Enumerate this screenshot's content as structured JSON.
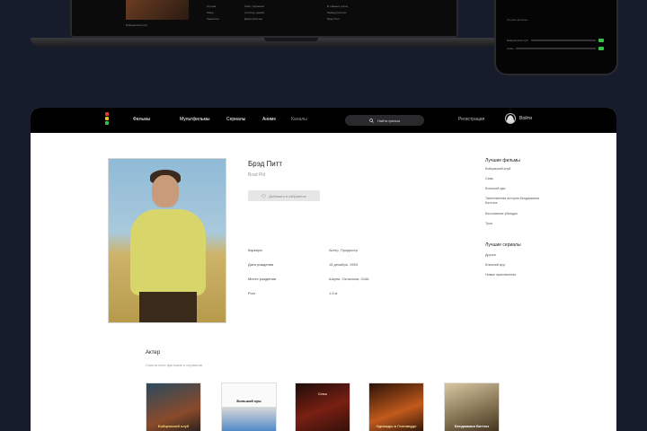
{
  "laptop_preview": {
    "caption": "Бойцовский клуб",
    "col1": [
      "Страна",
      "Жанр",
      "Режиссёр"
    ],
    "col2": [
      "США, Германия",
      "триллер, драма",
      "Дэвид Финчер"
    ],
    "col3": [
      "В главных ролях",
      "Эдвард Нортон",
      "Брэд Питт"
    ]
  },
  "phone_preview": {
    "title": "Лучшие фильмы",
    "rows": [
      "Бойцовский клуб",
      "Семь"
    ]
  },
  "nav": {
    "items": [
      "Фильмы",
      "Мультфильмы",
      "Сериалы",
      "Аниме",
      "Каналы"
    ],
    "search_label": "Найти фильм",
    "signup": "Регистрация",
    "login": "Войти"
  },
  "actor": {
    "name": "Брэд Питт",
    "name_en": "Brad Pitt",
    "favorite_label": "Добавить в избранное",
    "details": [
      {
        "label": "Карьера",
        "value": "Актер, Продюсер"
      },
      {
        "label": "Дата рождения",
        "value": "18 декабря, 1963"
      },
      {
        "label": "Место рождения",
        "value": "Шауни, Оклахома, США"
      },
      {
        "label": "Рост",
        "value": "1.8 м"
      }
    ]
  },
  "sidebar": {
    "best_films_title": "Лучшие фильмы",
    "best_films": [
      "Бойцовский клуб",
      "Семь",
      "Большой куш",
      "Таинственная история Бенджамина Баттона",
      "Бесславные ублюдки",
      "Троя"
    ],
    "best_series_title": "Лучшие сериалы",
    "best_series": [
      "Друзья",
      "Ближний круг",
      "Новые приключения"
    ]
  },
  "filmography": {
    "title": "Актер",
    "subtitle": "Список всех фильмов и сериалов",
    "posters": [
      "Бойцовский клуб",
      "Большой куш",
      "Семь",
      "Однажды в Голливуде",
      "Бенджамин Баттон"
    ]
  },
  "colors": {
    "page_bg": "#161c2b",
    "nav_bg": "#000000",
    "logo_red": "#e23b2e",
    "logo_yellow": "#e6c21c",
    "logo_green": "#36c24a"
  }
}
